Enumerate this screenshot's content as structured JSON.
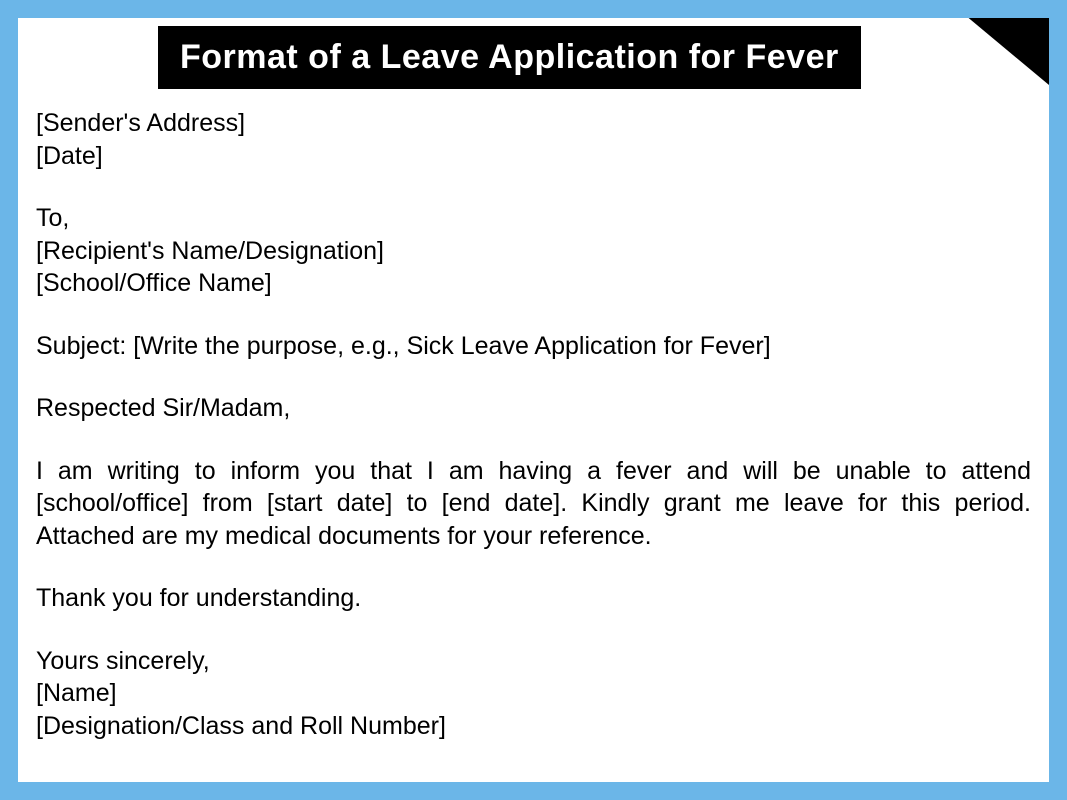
{
  "title": "Format of a Leave Application for Fever",
  "sender": {
    "address": "[Sender's Address]",
    "date": "[Date]"
  },
  "recipient": {
    "to": "To,",
    "name": "[Recipient's Name/Designation]",
    "org": "[School/Office Name]"
  },
  "subject": "Subject: [Write the purpose, e.g., Sick Leave Application for Fever]",
  "salutation": "Respected Sir/Madam,",
  "body": "I am writing to inform you that I am having a fever and will be unable to attend [school/office] from [start date] to [end date]. Kindly grant me leave for this period. Attached are my medical documents for your reference.",
  "thanks": "Thank you for understanding.",
  "closing": {
    "valediction": "Yours sincerely,",
    "name": "[Name]",
    "designation": "[Designation/Class and Roll Number]"
  }
}
